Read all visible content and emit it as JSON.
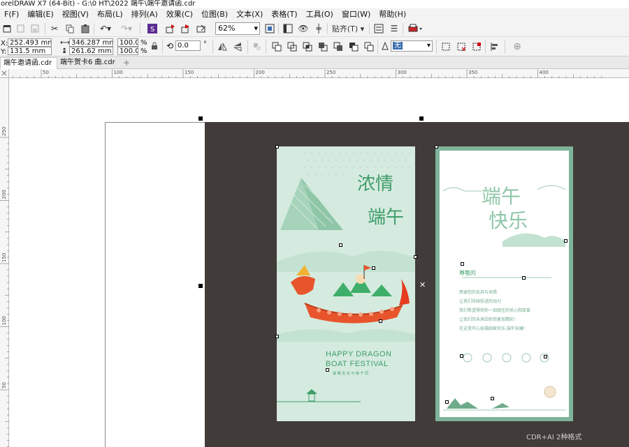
{
  "window": {
    "title": "orelDRAW X7 (64-Bit) - G:\\0 HT\\2022 端午\\端午邀请函.cdr"
  },
  "menu": [
    "F(F)",
    "编辑(E)",
    "视图(V)",
    "布局(L)",
    "排列(A)",
    "效果(C)",
    "位图(B)",
    "文本(X)",
    "表格(T)",
    "工具(O)",
    "窗口(W)",
    "帮助(H)"
  ],
  "toolbar": {
    "zoom_value": "62%",
    "snap_label": "贴齐(T)"
  },
  "property_bar": {
    "x_label": "X:",
    "x_value": "252.493 mm",
    "y_label": "Y:",
    "y_value": "131.5 mm",
    "width_value": "346.287 mm",
    "height_value": "261.62 mm",
    "scale_x": "100.0",
    "scale_y": "100.0",
    "percent": "%",
    "rotation_value": "0.0",
    "degree": "°",
    "outline_value": "无"
  },
  "tabs": [
    {
      "label": "端午邀请函.cdr",
      "active": true
    },
    {
      "label": "端午贺卡6 曲.cdr",
      "active": false
    }
  ],
  "tab_add": "+",
  "ruler": {
    "top_ticks": [
      "50",
      "100",
      "150",
      "200",
      "250",
      "300",
      "350",
      "400"
    ],
    "left_ticks": [
      "250",
      "200",
      "150",
      "100",
      "50"
    ]
  },
  "card1": {
    "title_line1": "HAPPY DRAGON",
    "title_line2": "BOAT FESTIVAL",
    "sub": "端 赛 龙 舟   与 粽 千 同"
  },
  "card2": {
    "greeting": "尊敬的",
    "lines": [
      "感谢您的支持与关照",
      "让我们持续前进的动力",
      "我们希望得到你一如既往的关心和厚爱",
      "让我们的未来因你而更加精彩!",
      "在这里开心祝福阖家欢乐,端午安康!"
    ]
  },
  "watermark": "CDR+AI 2种格式",
  "colors": {
    "card1_bg": "#d5ebdf",
    "card2_border": "#7fb49a",
    "accent_green": "#3f9d6a",
    "dark_bg": "#413b39"
  }
}
